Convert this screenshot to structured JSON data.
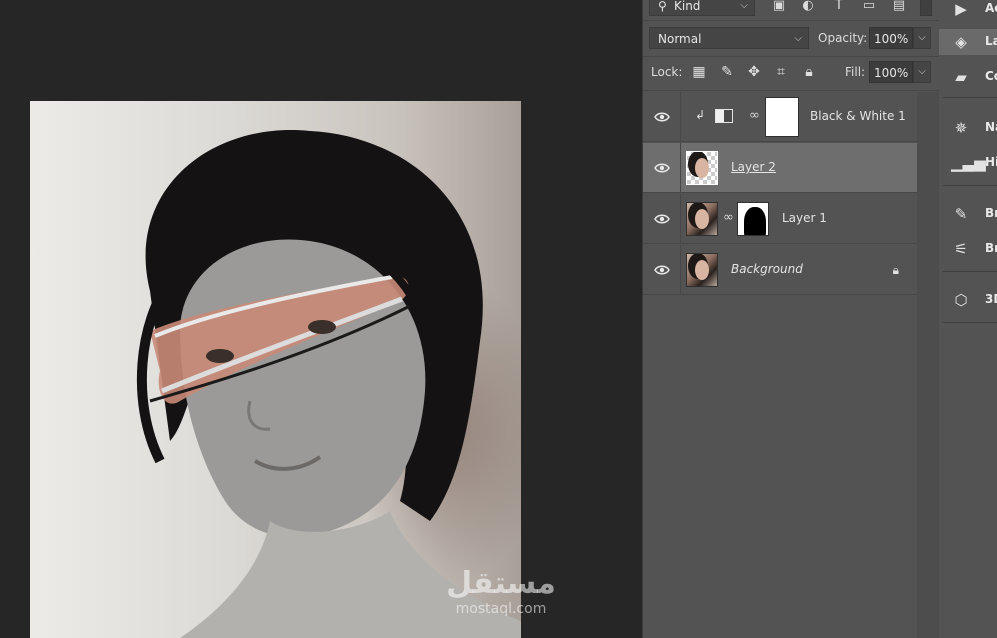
{
  "canvas": {
    "watermark_arabic": "مستقل",
    "watermark_latin": "mostaql.com"
  },
  "layers_panel": {
    "filter": {
      "kind_label": "Kind",
      "icons": [
        "image-filter-icon",
        "adjustment-filter-icon",
        "type-filter-icon",
        "shape-filter-icon",
        "smart-object-filter-icon"
      ]
    },
    "blend_mode": "Normal",
    "opacity_label": "Opacity:",
    "opacity_value": "100%",
    "lock_label": "Lock:",
    "fill_label": "Fill:",
    "fill_value": "100%",
    "layers": [
      {
        "name": "Black & White 1",
        "type": "adjustment",
        "visible": true,
        "selected": false
      },
      {
        "name": "Layer 2",
        "type": "pixel",
        "visible": true,
        "selected": true
      },
      {
        "name": "Layer 1",
        "type": "masked",
        "visible": true,
        "selected": false
      },
      {
        "name": "Background",
        "type": "background",
        "visible": true,
        "selected": false,
        "locked": true
      }
    ]
  },
  "dock": {
    "items": [
      {
        "label": "Ac",
        "icon": "play-icon"
      },
      {
        "label": "La",
        "icon": "layers-icon",
        "active": true
      },
      {
        "label": "Co",
        "icon": "comment-icon"
      },
      {
        "label": "Na",
        "icon": "navigator-icon"
      },
      {
        "label": "Hi",
        "icon": "histogram-icon"
      },
      {
        "label": "Br",
        "icon": "brush-icon"
      },
      {
        "label": "Br",
        "icon": "brush-settings-icon"
      },
      {
        "label": "3D",
        "icon": "cube-icon"
      }
    ]
  },
  "colors": {
    "panel_bg": "#535353",
    "canvas_bg": "#262626",
    "selected_row": "#6e6e6e"
  }
}
